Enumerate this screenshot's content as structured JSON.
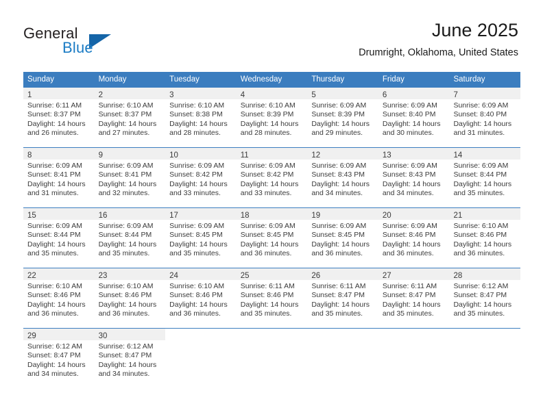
{
  "brand": {
    "name_top": "General",
    "name_bottom": "Blue",
    "accent_color": "#1a7bc4",
    "triangle_color": "#1565a8"
  },
  "header": {
    "title": "June 2025",
    "subtitle": "Drumright, Oklahoma, United States"
  },
  "calendar": {
    "header_bg": "#3b7dbf",
    "daynum_bg": "#f0f0f0",
    "weekdays": [
      "Sunday",
      "Monday",
      "Tuesday",
      "Wednesday",
      "Thursday",
      "Friday",
      "Saturday"
    ],
    "weeks": [
      [
        {
          "day": "1",
          "sunrise": "Sunrise: 6:11 AM",
          "sunset": "Sunset: 8:37 PM",
          "daylight1": "Daylight: 14 hours",
          "daylight2": "and 26 minutes."
        },
        {
          "day": "2",
          "sunrise": "Sunrise: 6:10 AM",
          "sunset": "Sunset: 8:37 PM",
          "daylight1": "Daylight: 14 hours",
          "daylight2": "and 27 minutes."
        },
        {
          "day": "3",
          "sunrise": "Sunrise: 6:10 AM",
          "sunset": "Sunset: 8:38 PM",
          "daylight1": "Daylight: 14 hours",
          "daylight2": "and 28 minutes."
        },
        {
          "day": "4",
          "sunrise": "Sunrise: 6:10 AM",
          "sunset": "Sunset: 8:39 PM",
          "daylight1": "Daylight: 14 hours",
          "daylight2": "and 28 minutes."
        },
        {
          "day": "5",
          "sunrise": "Sunrise: 6:09 AM",
          "sunset": "Sunset: 8:39 PM",
          "daylight1": "Daylight: 14 hours",
          "daylight2": "and 29 minutes."
        },
        {
          "day": "6",
          "sunrise": "Sunrise: 6:09 AM",
          "sunset": "Sunset: 8:40 PM",
          "daylight1": "Daylight: 14 hours",
          "daylight2": "and 30 minutes."
        },
        {
          "day": "7",
          "sunrise": "Sunrise: 6:09 AM",
          "sunset": "Sunset: 8:40 PM",
          "daylight1": "Daylight: 14 hours",
          "daylight2": "and 31 minutes."
        }
      ],
      [
        {
          "day": "8",
          "sunrise": "Sunrise: 6:09 AM",
          "sunset": "Sunset: 8:41 PM",
          "daylight1": "Daylight: 14 hours",
          "daylight2": "and 31 minutes."
        },
        {
          "day": "9",
          "sunrise": "Sunrise: 6:09 AM",
          "sunset": "Sunset: 8:41 PM",
          "daylight1": "Daylight: 14 hours",
          "daylight2": "and 32 minutes."
        },
        {
          "day": "10",
          "sunrise": "Sunrise: 6:09 AM",
          "sunset": "Sunset: 8:42 PM",
          "daylight1": "Daylight: 14 hours",
          "daylight2": "and 33 minutes."
        },
        {
          "day": "11",
          "sunrise": "Sunrise: 6:09 AM",
          "sunset": "Sunset: 8:42 PM",
          "daylight1": "Daylight: 14 hours",
          "daylight2": "and 33 minutes."
        },
        {
          "day": "12",
          "sunrise": "Sunrise: 6:09 AM",
          "sunset": "Sunset: 8:43 PM",
          "daylight1": "Daylight: 14 hours",
          "daylight2": "and 34 minutes."
        },
        {
          "day": "13",
          "sunrise": "Sunrise: 6:09 AM",
          "sunset": "Sunset: 8:43 PM",
          "daylight1": "Daylight: 14 hours",
          "daylight2": "and 34 minutes."
        },
        {
          "day": "14",
          "sunrise": "Sunrise: 6:09 AM",
          "sunset": "Sunset: 8:44 PM",
          "daylight1": "Daylight: 14 hours",
          "daylight2": "and 35 minutes."
        }
      ],
      [
        {
          "day": "15",
          "sunrise": "Sunrise: 6:09 AM",
          "sunset": "Sunset: 8:44 PM",
          "daylight1": "Daylight: 14 hours",
          "daylight2": "and 35 minutes."
        },
        {
          "day": "16",
          "sunrise": "Sunrise: 6:09 AM",
          "sunset": "Sunset: 8:44 PM",
          "daylight1": "Daylight: 14 hours",
          "daylight2": "and 35 minutes."
        },
        {
          "day": "17",
          "sunrise": "Sunrise: 6:09 AM",
          "sunset": "Sunset: 8:45 PM",
          "daylight1": "Daylight: 14 hours",
          "daylight2": "and 35 minutes."
        },
        {
          "day": "18",
          "sunrise": "Sunrise: 6:09 AM",
          "sunset": "Sunset: 8:45 PM",
          "daylight1": "Daylight: 14 hours",
          "daylight2": "and 36 minutes."
        },
        {
          "day": "19",
          "sunrise": "Sunrise: 6:09 AM",
          "sunset": "Sunset: 8:45 PM",
          "daylight1": "Daylight: 14 hours",
          "daylight2": "and 36 minutes."
        },
        {
          "day": "20",
          "sunrise": "Sunrise: 6:09 AM",
          "sunset": "Sunset: 8:46 PM",
          "daylight1": "Daylight: 14 hours",
          "daylight2": "and 36 minutes."
        },
        {
          "day": "21",
          "sunrise": "Sunrise: 6:10 AM",
          "sunset": "Sunset: 8:46 PM",
          "daylight1": "Daylight: 14 hours",
          "daylight2": "and 36 minutes."
        }
      ],
      [
        {
          "day": "22",
          "sunrise": "Sunrise: 6:10 AM",
          "sunset": "Sunset: 8:46 PM",
          "daylight1": "Daylight: 14 hours",
          "daylight2": "and 36 minutes."
        },
        {
          "day": "23",
          "sunrise": "Sunrise: 6:10 AM",
          "sunset": "Sunset: 8:46 PM",
          "daylight1": "Daylight: 14 hours",
          "daylight2": "and 36 minutes."
        },
        {
          "day": "24",
          "sunrise": "Sunrise: 6:10 AM",
          "sunset": "Sunset: 8:46 PM",
          "daylight1": "Daylight: 14 hours",
          "daylight2": "and 36 minutes."
        },
        {
          "day": "25",
          "sunrise": "Sunrise: 6:11 AM",
          "sunset": "Sunset: 8:46 PM",
          "daylight1": "Daylight: 14 hours",
          "daylight2": "and 35 minutes."
        },
        {
          "day": "26",
          "sunrise": "Sunrise: 6:11 AM",
          "sunset": "Sunset: 8:47 PM",
          "daylight1": "Daylight: 14 hours",
          "daylight2": "and 35 minutes."
        },
        {
          "day": "27",
          "sunrise": "Sunrise: 6:11 AM",
          "sunset": "Sunset: 8:47 PM",
          "daylight1": "Daylight: 14 hours",
          "daylight2": "and 35 minutes."
        },
        {
          "day": "28",
          "sunrise": "Sunrise: 6:12 AM",
          "sunset": "Sunset: 8:47 PM",
          "daylight1": "Daylight: 14 hours",
          "daylight2": "and 35 minutes."
        }
      ],
      [
        {
          "day": "29",
          "sunrise": "Sunrise: 6:12 AM",
          "sunset": "Sunset: 8:47 PM",
          "daylight1": "Daylight: 14 hours",
          "daylight2": "and 34 minutes."
        },
        {
          "day": "30",
          "sunrise": "Sunrise: 6:12 AM",
          "sunset": "Sunset: 8:47 PM",
          "daylight1": "Daylight: 14 hours",
          "daylight2": "and 34 minutes."
        },
        {
          "day": "",
          "sunrise": "",
          "sunset": "",
          "daylight1": "",
          "daylight2": ""
        },
        {
          "day": "",
          "sunrise": "",
          "sunset": "",
          "daylight1": "",
          "daylight2": ""
        },
        {
          "day": "",
          "sunrise": "",
          "sunset": "",
          "daylight1": "",
          "daylight2": ""
        },
        {
          "day": "",
          "sunrise": "",
          "sunset": "",
          "daylight1": "",
          "daylight2": ""
        },
        {
          "day": "",
          "sunrise": "",
          "sunset": "",
          "daylight1": "",
          "daylight2": ""
        }
      ]
    ]
  }
}
